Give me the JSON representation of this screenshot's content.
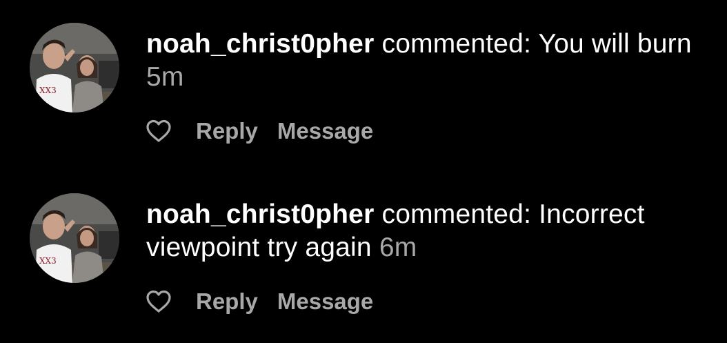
{
  "notifications": [
    {
      "username": "noah_christ0pher",
      "action_text": " commented: ",
      "comment": "You will burn",
      "time": "5m",
      "like_icon": "heart-outline-icon",
      "reply_label": "Reply",
      "message_label": "Message"
    },
    {
      "username": "noah_christ0pher",
      "action_text": " commented: ",
      "comment": "Incorrect viewpoint try again",
      "time": "6m",
      "like_icon": "heart-outline-icon",
      "reply_label": "Reply",
      "message_label": "Message"
    }
  ],
  "colors": {
    "background": "#000000",
    "primary_text": "#ffffff",
    "secondary_text": "#a8a8a8"
  }
}
